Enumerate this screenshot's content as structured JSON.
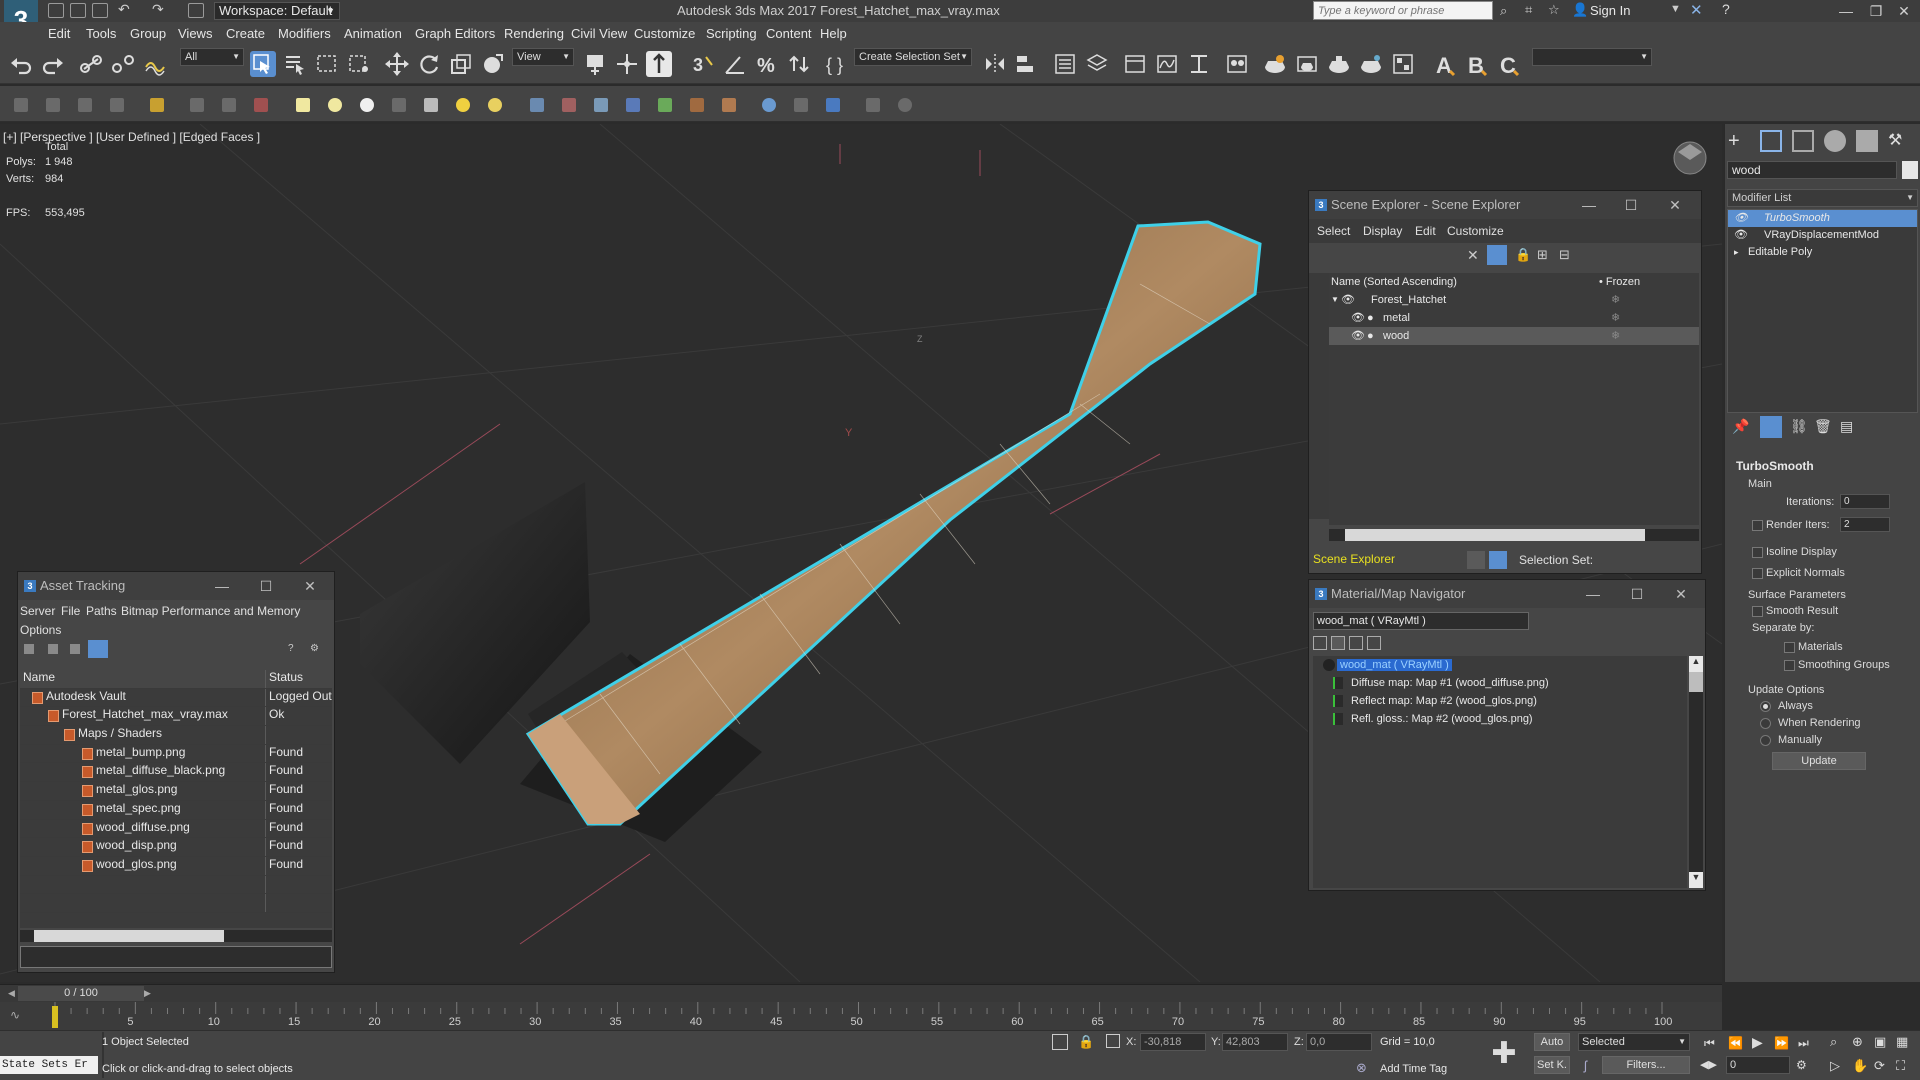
{
  "titlebar": {
    "workspace": "Workspace: Default",
    "title": "Autodesk 3ds Max 2017     Forest_Hatchet_max_vray.max",
    "search_placeholder": "Type a keyword or phrase",
    "sign_in": "Sign In"
  },
  "menu": [
    "Edit",
    "Tools",
    "Group",
    "Views",
    "Create",
    "Modifiers",
    "Animation",
    "Graph Editors",
    "Rendering",
    "Civil View",
    "Customize",
    "Scripting",
    "Content",
    "Help"
  ],
  "toolbar": {
    "filter_value": "All",
    "view_value": "View",
    "selection_set": "Create Selection Set"
  },
  "viewport": {
    "label": "[+] [Perspective ]  [User Defined ]  [Edged Faces ]",
    "total_label": "Total",
    "polys_label": "Polys:",
    "polys_value": "1 948",
    "verts_label": "Verts:",
    "verts_value": "984",
    "fps_label": "FPS:",
    "fps_value": "553,495"
  },
  "command_panel": {
    "object_name": "wood",
    "modifier_list": "Modifier List",
    "stack": [
      "TurboSmooth",
      "VRayDisplacementMod",
      "Editable Poly"
    ],
    "turbosmooth": {
      "title": "TurboSmooth",
      "main": "Main",
      "iterations_label": "Iterations:",
      "iterations_value": "0",
      "render_iters_label": "Render Iters:",
      "render_iters_value": "2",
      "isoline": "Isoline Display",
      "explicit_normals": "Explicit Normals",
      "surface_params": "Surface Parameters",
      "smooth_result": "Smooth Result",
      "separate_by": "Separate by:",
      "materials": "Materials",
      "smoothing_groups": "Smoothing Groups",
      "update_options": "Update Options",
      "always": "Always",
      "when_rendering": "When Rendering",
      "manually": "Manually",
      "update_btn": "Update"
    }
  },
  "scene_explorer": {
    "title": "Scene Explorer - Scene Explorer",
    "menu": [
      "Select",
      "Display",
      "Edit",
      "Customize"
    ],
    "col_name": "Name (Sorted Ascending)",
    "col_frozen": "Frozen",
    "rows": [
      "Forest_Hatchet",
      "metal",
      "wood"
    ],
    "footer_name": "Scene Explorer",
    "selection_set_label": "Selection Set:"
  },
  "material_navigator": {
    "title": "Material/Map Navigator",
    "material_field": "wood_mat  ( VRayMtl )",
    "root": "wood_mat  ( VRayMtl )",
    "maps": [
      "Diffuse map: Map #1 (wood_diffuse.png)",
      "Reflect map: Map #2 (wood_glos.png)",
      "Refl. gloss.: Map #2 (wood_glos.png)"
    ]
  },
  "asset_tracking": {
    "title": "Asset Tracking",
    "menu": [
      "Server",
      "File",
      "Paths",
      "Bitmap Performance and Memory"
    ],
    "menu2": "Options",
    "col_name": "Name",
    "col_status": "Status",
    "rows": [
      {
        "name": "Autodesk Vault",
        "status": "Logged Out",
        "indent": 0
      },
      {
        "name": "Forest_Hatchet_max_vray.max",
        "status": "Ok",
        "indent": 1
      },
      {
        "name": "Maps / Shaders",
        "status": "",
        "indent": 2
      },
      {
        "name": "metal_bump.png",
        "status": "Found",
        "indent": 3
      },
      {
        "name": "metal_diffuse_black.png",
        "status": "Found",
        "indent": 3
      },
      {
        "name": "metal_glos.png",
        "status": "Found",
        "indent": 3
      },
      {
        "name": "metal_spec.png",
        "status": "Found",
        "indent": 3
      },
      {
        "name": "wood_diffuse.png",
        "status": "Found",
        "indent": 3
      },
      {
        "name": "wood_disp.png",
        "status": "Found",
        "indent": 3
      },
      {
        "name": "wood_glos.png",
        "status": "Found",
        "indent": 3
      }
    ]
  },
  "timeline": {
    "frame": "0 / 100",
    "ticks": [
      "5",
      "10",
      "15",
      "20",
      "25",
      "30",
      "35",
      "40",
      "45",
      "50",
      "55",
      "60",
      "65",
      "70",
      "75",
      "80",
      "85",
      "90",
      "95",
      "100"
    ]
  },
  "status": {
    "state_sets": "State Sets Er",
    "selected": "1 Object Selected",
    "prompt": "Click or click-and-drag to select objects",
    "x_label": "X:",
    "x_value": "-30,818",
    "y_label": "Y:",
    "y_value": "42,803",
    "z_label": "Z:",
    "z_value": "0,0",
    "grid": "Grid = 10,0",
    "add_time_tag": "Add Time Tag",
    "auto": "Auto",
    "selected_dd": "Selected",
    "set_k": "Set K.",
    "filters": "Filters...",
    "frame_field": "0"
  },
  "colors": {
    "accent": "#5a8fd0",
    "selection_outline": "#3fd0e8",
    "stat_yellow": "#ffe24a"
  }
}
